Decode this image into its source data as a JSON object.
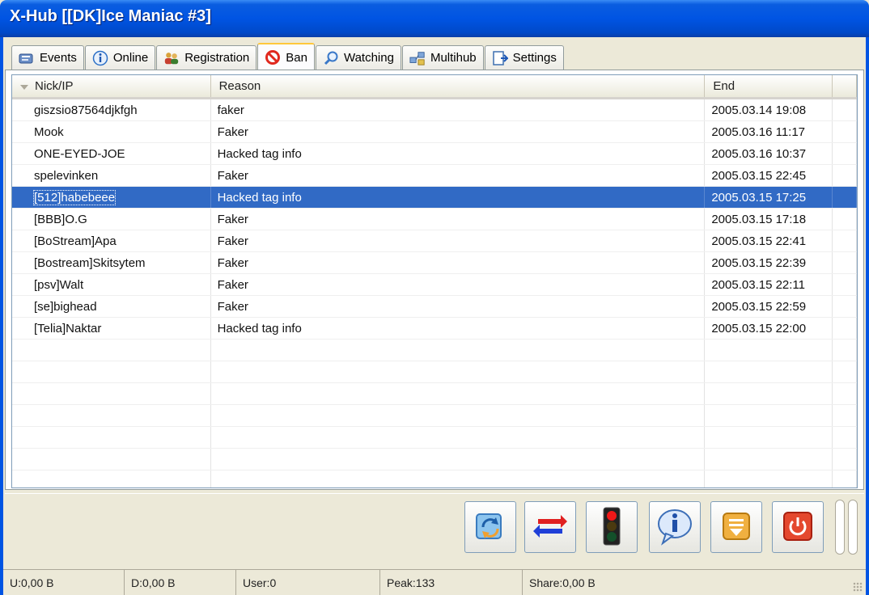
{
  "window": {
    "title": "X-Hub [[DK]Ice Maniac #3]"
  },
  "tabs": [
    {
      "label": "Events",
      "icon": "events-icon"
    },
    {
      "label": "Online",
      "icon": "info-icon"
    },
    {
      "label": "Registration",
      "icon": "users-icon"
    },
    {
      "label": "Ban",
      "icon": "ban-icon",
      "active": true
    },
    {
      "label": "Watching",
      "icon": "magnifier-icon"
    },
    {
      "label": "Multihub",
      "icon": "network-icon"
    },
    {
      "label": "Settings",
      "icon": "settings-icon"
    }
  ],
  "table": {
    "columns": [
      "Nick/IP",
      "Reason",
      "End"
    ],
    "rows": [
      {
        "nick": "giszsio87564djkfgh",
        "reason": "faker",
        "end": "2005.03.14 19:08"
      },
      {
        "nick": "Mook",
        "reason": "Faker",
        "end": "2005.03.16 11:17"
      },
      {
        "nick": "ONE-EYED-JOE",
        "reason": "Hacked tag info",
        "end": "2005.03.16 10:37"
      },
      {
        "nick": "spelevinken",
        "reason": "Faker",
        "end": "2005.03.15 22:45"
      },
      {
        "nick": "[512]habebeee",
        "reason": "Hacked tag info",
        "end": "2005.03.15 17:25",
        "selected": true
      },
      {
        "nick": "[BBB]O.G",
        "reason": "Faker",
        "end": "2005.03.15 17:18"
      },
      {
        "nick": "[BoStream]Apa",
        "reason": "Faker",
        "end": "2005.03.15 22:41"
      },
      {
        "nick": "[Bostream]Skitsytem",
        "reason": "Faker",
        "end": "2005.03.15 22:39"
      },
      {
        "nick": "[psv]Walt",
        "reason": "Faker",
        "end": "2005.03.15 22:11"
      },
      {
        "nick": "[se]bighead",
        "reason": "Faker",
        "end": "2005.03.15 22:59"
      },
      {
        "nick": "[Telia]Naktar",
        "reason": "Hacked tag info",
        "end": "2005.03.15 22:00"
      }
    ]
  },
  "toolbar": {
    "buttons": [
      "refresh-icon",
      "transfer-icon",
      "traffic-light-icon",
      "info-icon",
      "scroll-down-icon",
      "power-icon"
    ]
  },
  "status": {
    "upload": "U:0,00 B",
    "download": "D:0,00 B",
    "users": "User:0",
    "peak": "Peak:133",
    "share": "Share:0,00 B"
  }
}
